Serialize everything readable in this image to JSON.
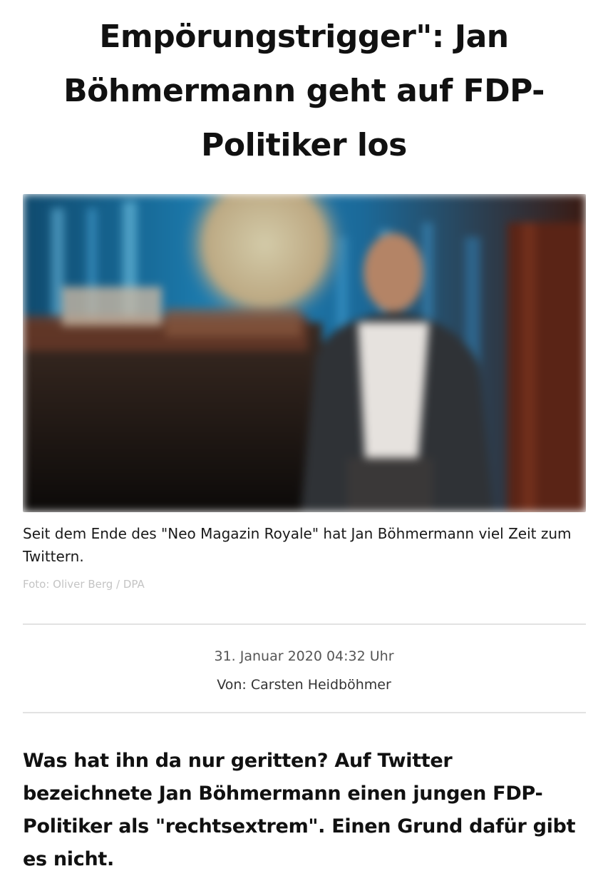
{
  "article": {
    "headline": "Empörungstrigger\": Jan Böhmermann geht auf FDP-Politiker los",
    "image": {
      "caption": "Seit dem Ende des \"Neo Magazin Royale\" hat Jan Böhmermann viel Zeit zum Twittern.",
      "credit": "Foto: Oliver Berg / DPA"
    },
    "date": "31. Januar 2020 04:32 Uhr",
    "author": "Von: Carsten Heidböhmer",
    "lead": "Was hat ihn da nur geritten? Auf Twitter bezeichnete Jan Böhmermann einen jungen FDP-Politiker als \"rechtsextrem\". Einen Grund dafür gibt es nicht."
  }
}
